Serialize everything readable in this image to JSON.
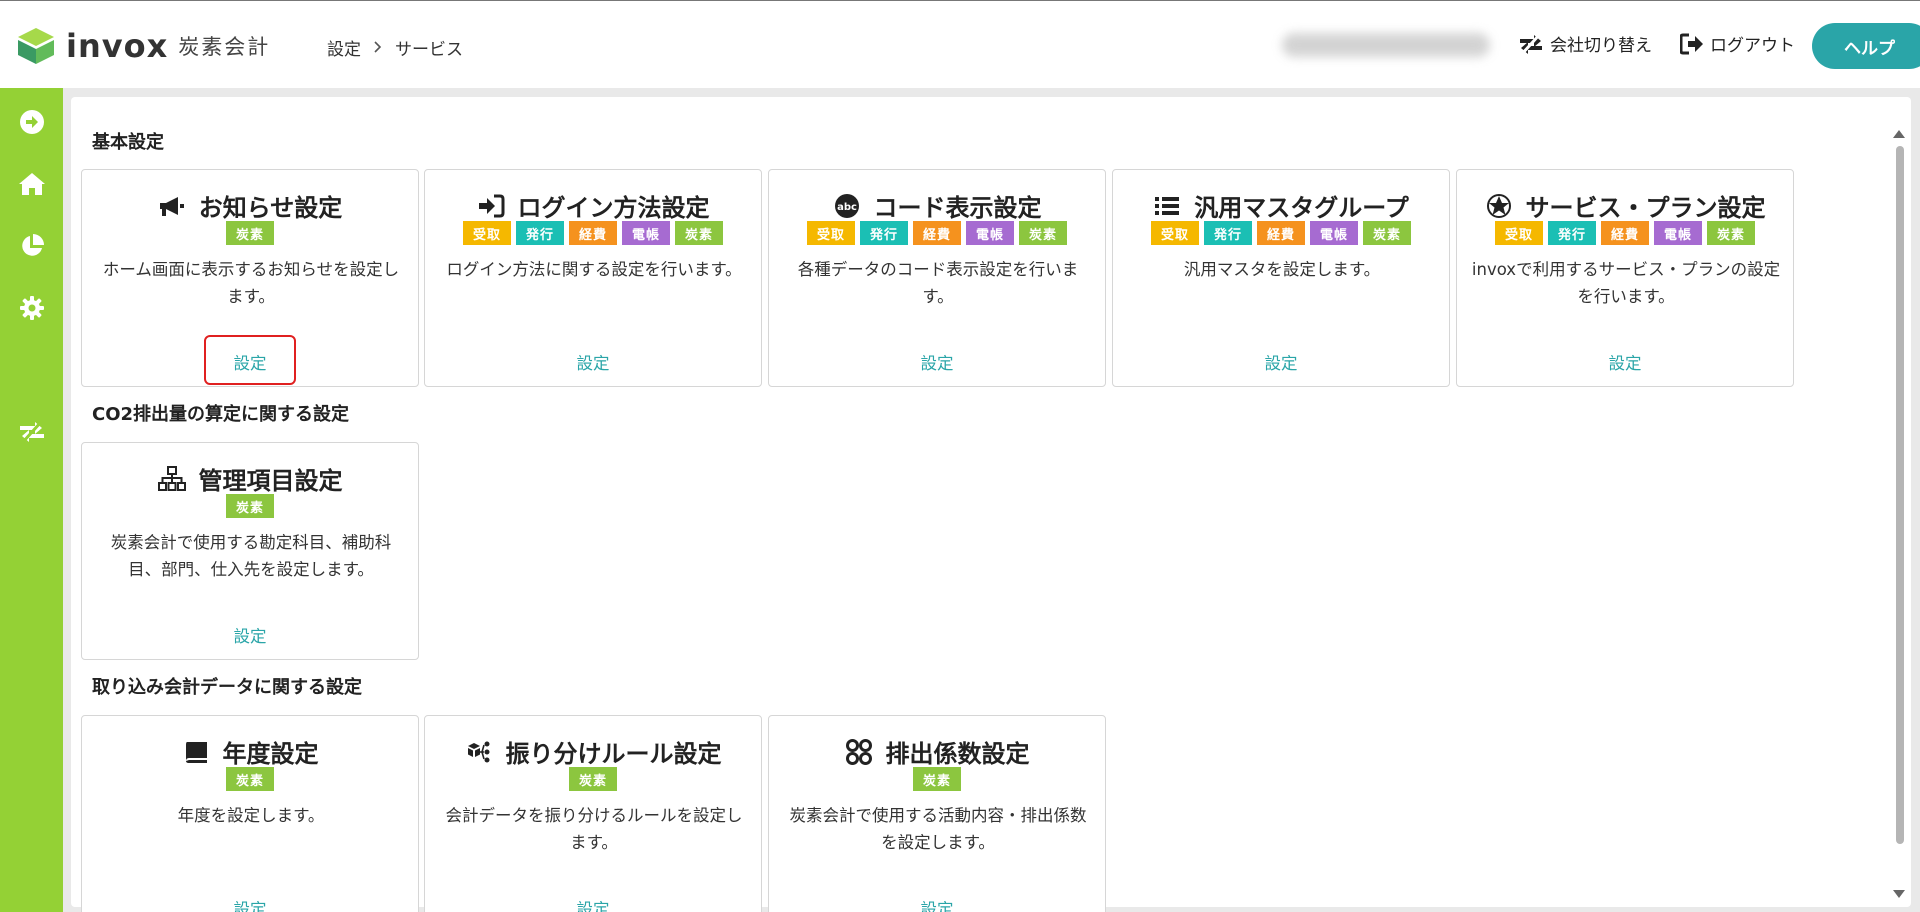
{
  "header": {
    "logo_text": "invox",
    "logo_sub": "炭素会計",
    "breadcrumb": [
      "設定",
      "サービス"
    ],
    "switch_company": "会社切り替え",
    "logout": "ログアウト",
    "help": "ヘルプ"
  },
  "sidebar": {
    "items": [
      {
        "icon": "arrow-circle-right-icon"
      },
      {
        "icon": "home-icon"
      },
      {
        "icon": "pie-chart-icon"
      },
      {
        "icon": "gear-icon"
      },
      {
        "icon": "switch-icon"
      }
    ]
  },
  "tag_colors": {
    "受取": "#f5b800",
    "発行": "#1bbfb4",
    "経費": "#f5921e",
    "電帳": "#a66bd1",
    "炭素": "#8cc63f"
  },
  "sections": [
    {
      "title": "基本設定",
      "cards": [
        {
          "title": "お知らせ設定",
          "icon": "megaphone-icon",
          "tags": [
            "炭素"
          ],
          "desc": [
            "ホーム画面に表示するお知らせを設定し",
            "ます。"
          ],
          "link": "設定"
        },
        {
          "title": "ログイン方法設定",
          "icon": "sign-in-icon",
          "tags": [
            "受取",
            "発行",
            "経費",
            "電帳",
            "炭素"
          ],
          "desc": [
            "ログイン方法に関する設定を行います。"
          ],
          "link": "設定"
        },
        {
          "title": "コード表示設定",
          "icon": "abc-icon",
          "tags": [
            "受取",
            "発行",
            "経費",
            "電帳",
            "炭素"
          ],
          "desc": [
            "各種データのコード表示設定を行いま",
            "す。"
          ],
          "link": "設定"
        },
        {
          "title": "汎用マスタグループ",
          "icon": "list-icon",
          "tags": [
            "受取",
            "発行",
            "経費",
            "電帳",
            "炭素"
          ],
          "desc": [
            "汎用マスタを設定します。"
          ],
          "link": "設定"
        },
        {
          "title": "サービス・プラン設定",
          "icon": "star-badge-icon",
          "tags": [
            "受取",
            "発行",
            "経費",
            "電帳",
            "炭素"
          ],
          "desc": [
            "invoxで利用するサービス・プランの設定",
            "を行います。"
          ],
          "link": "設定"
        }
      ]
    },
    {
      "title": "CO2排出量の算定に関する設定",
      "cards": [
        {
          "title": "管理項目設定",
          "icon": "sitemap-icon",
          "tags": [
            "炭素"
          ],
          "desc": [
            "炭素会計で使用する勘定科目、補助科",
            "目、部門、仕入先を設定します。"
          ],
          "link": "設定"
        }
      ]
    },
    {
      "title": "取り込み会計データに関する設定",
      "cards": [
        {
          "title": "年度設定",
          "icon": "book-icon",
          "tags": [
            "炭素"
          ],
          "desc": [
            "年度を設定します。"
          ],
          "link": "設定"
        },
        {
          "title": "振り分けルール設定",
          "icon": "route-icon",
          "tags": [
            "炭素"
          ],
          "desc": [
            "会計データを振り分けるルールを設定し",
            "ます。"
          ],
          "link": "設定"
        },
        {
          "title": "排出係数設定",
          "icon": "grid-circles-icon",
          "tags": [
            "炭素"
          ],
          "desc": [
            "炭素会計で使用する活動内容・排出係数",
            "を設定します。"
          ],
          "link": "設定"
        }
      ]
    }
  ]
}
